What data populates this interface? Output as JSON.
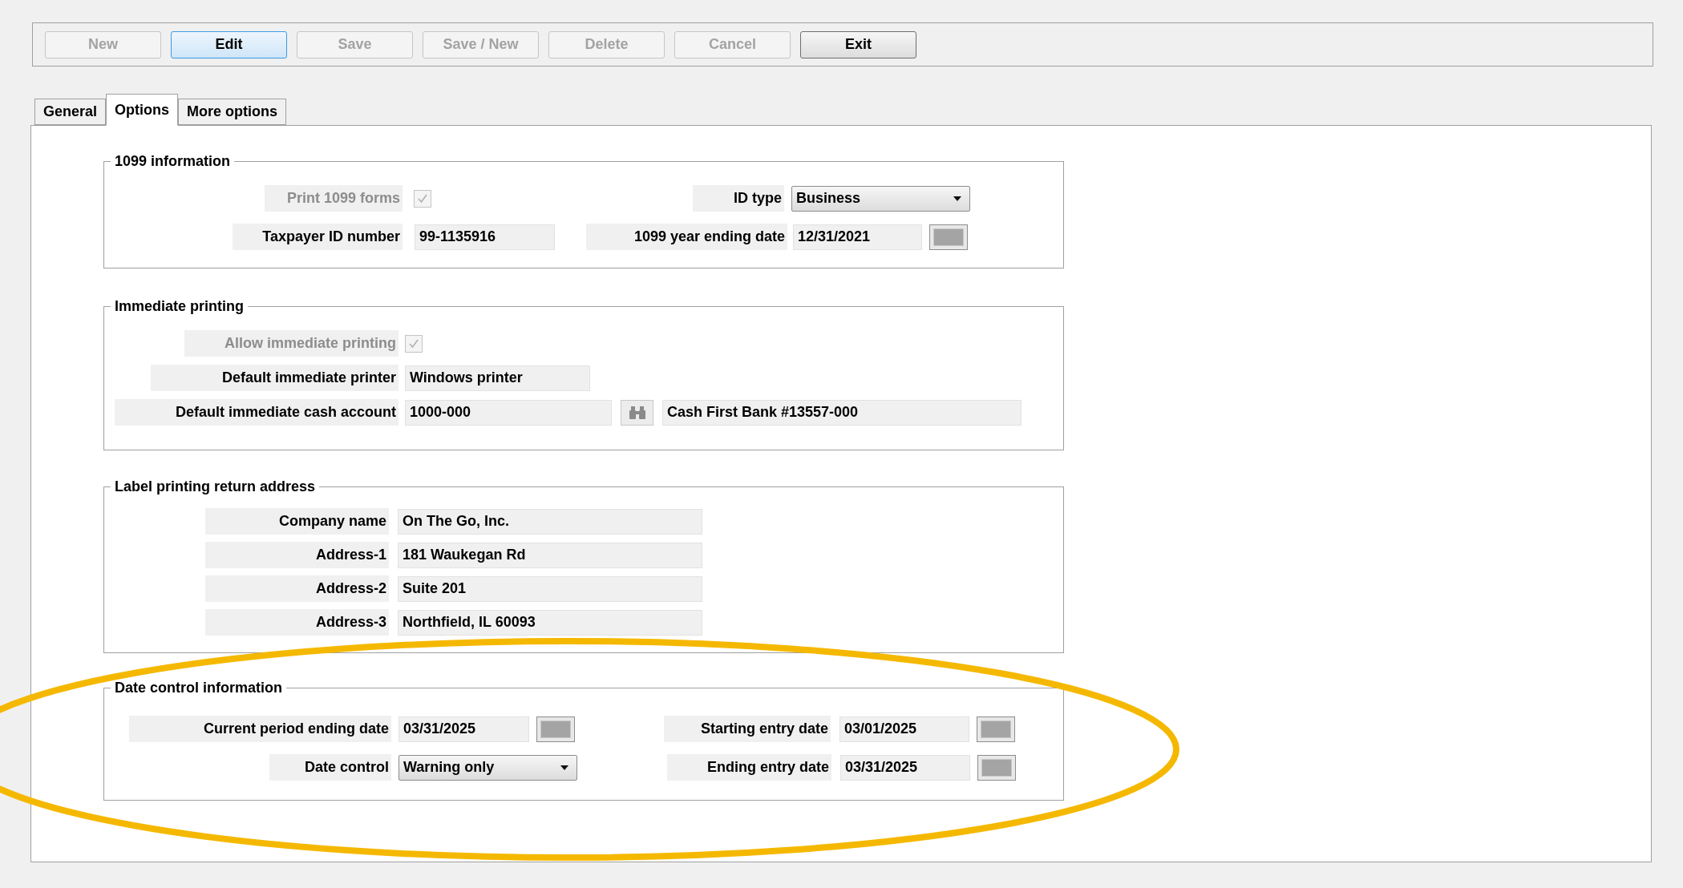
{
  "toolbar": {
    "buttons": [
      {
        "label": "New",
        "disabled": true,
        "focused": false
      },
      {
        "label": "Edit",
        "disabled": false,
        "focused": true
      },
      {
        "label": "Save",
        "disabled": true,
        "focused": false
      },
      {
        "label": "Save / New",
        "disabled": true,
        "focused": false
      },
      {
        "label": "Delete",
        "disabled": true,
        "focused": false
      },
      {
        "label": "Cancel",
        "disabled": true,
        "focused": false
      },
      {
        "label": "Exit",
        "disabled": false,
        "focused": false
      }
    ]
  },
  "tabs": [
    {
      "label": "General",
      "selected": false
    },
    {
      "label": "Options",
      "selected": true
    },
    {
      "label": "More options",
      "selected": false
    }
  ],
  "sections": [
    {
      "title": "1099 information",
      "rows": [
        [
          {
            "kind": "checkbox",
            "label": "Print 1099 forms",
            "checked": true,
            "disabled": true
          },
          {
            "kind": "dropdown",
            "label": "ID type",
            "value": "Business"
          }
        ],
        [
          {
            "kind": "text",
            "label": "Taxpayer ID number",
            "value": "99-1135916"
          },
          {
            "kind": "date",
            "label": "1099 year ending date",
            "value": "12/31/2021"
          }
        ]
      ]
    },
    {
      "title": "Immediate printing",
      "rows": [
        [
          {
            "kind": "checkbox",
            "label": "Allow immediate printing",
            "checked": true,
            "disabled": true
          }
        ],
        [
          {
            "kind": "text",
            "label": "Default immediate printer",
            "value": "Windows printer"
          }
        ],
        [
          {
            "kind": "lookup",
            "label": "Default immediate cash account",
            "value": "1000-000",
            "description": "Cash First Bank #13557-000"
          }
        ]
      ]
    },
    {
      "title": "Label printing return address",
      "rows": [
        [
          {
            "kind": "text",
            "label": "Company name",
            "value": "On The Go, Inc."
          }
        ],
        [
          {
            "kind": "text",
            "label": "Address-1",
            "value": "181 Waukegan Rd"
          }
        ],
        [
          {
            "kind": "text",
            "label": "Address-2",
            "value": "Suite 201"
          }
        ],
        [
          {
            "kind": "text",
            "label": "Address-3",
            "value": "Northfield, IL 60093"
          }
        ]
      ]
    },
    {
      "title": "Date control information",
      "rows": [
        [
          {
            "kind": "date",
            "label": "Current period ending date",
            "value": "03/31/2025"
          },
          {
            "kind": "date",
            "label": "Starting entry date",
            "value": "03/01/2025"
          }
        ],
        [
          {
            "kind": "dropdown",
            "label": "Date control",
            "value": "Warning only"
          },
          {
            "kind": "date",
            "label": "Ending entry date",
            "value": "03/31/2025"
          }
        ]
      ]
    }
  ]
}
